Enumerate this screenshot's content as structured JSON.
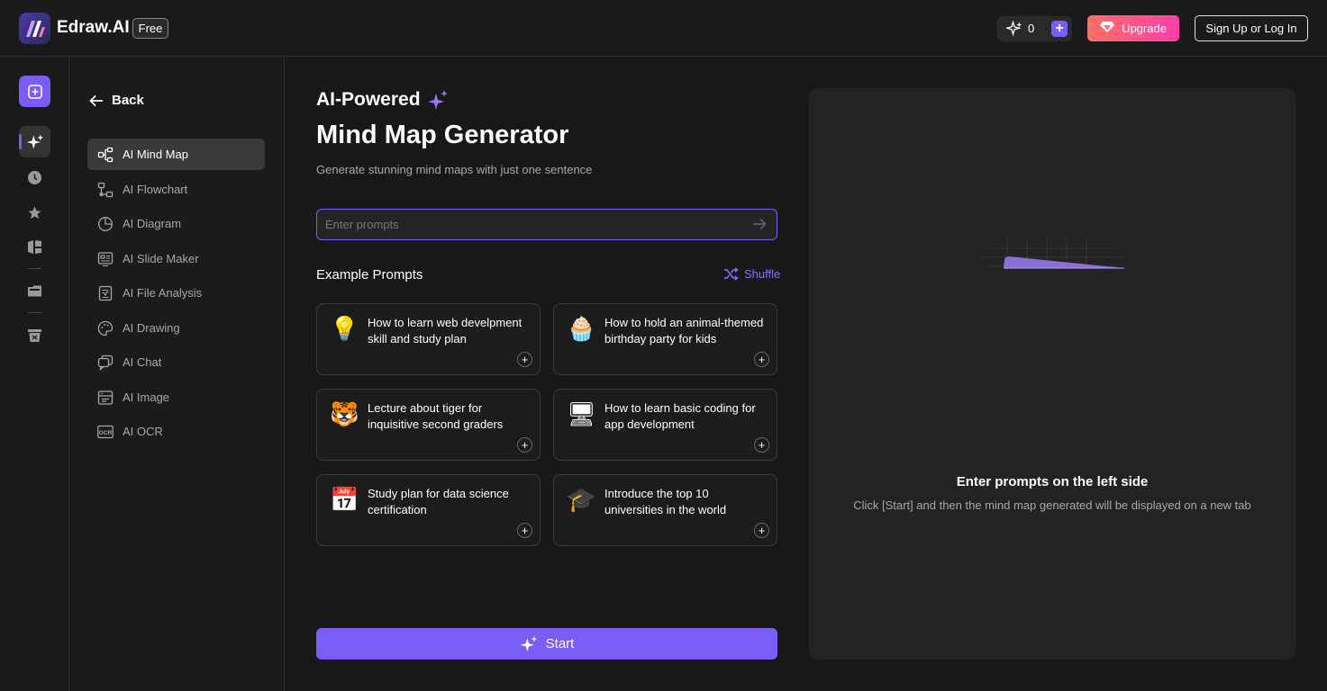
{
  "header": {
    "app_name": "Edraw.AI",
    "plan_badge": "Free",
    "credits": "0",
    "upgrade_label": "Upgrade",
    "signup_label": "Sign Up or Log In"
  },
  "rail": {
    "items": [
      "new-icon",
      "ai-sparkle-icon",
      "clock-icon",
      "star-icon",
      "templates-icon",
      "folder-icon",
      "trash-icon"
    ]
  },
  "sidebar": {
    "back_label": "Back",
    "items": [
      {
        "label": "AI Mind Map",
        "icon": "mind-map-icon",
        "active": true
      },
      {
        "label": "AI Flowchart",
        "icon": "flowchart-icon"
      },
      {
        "label": "AI Diagram",
        "icon": "diagram-icon"
      },
      {
        "label": "AI Slide Maker",
        "icon": "slide-icon"
      },
      {
        "label": "AI File Analysis",
        "icon": "file-analysis-icon"
      },
      {
        "label": "AI Drawing",
        "icon": "palette-icon"
      },
      {
        "label": "AI Chat",
        "icon": "chat-icon"
      },
      {
        "label": "AI Image",
        "icon": "image-icon"
      },
      {
        "label": "AI OCR",
        "icon": "ocr-icon"
      }
    ]
  },
  "main": {
    "eyebrow": "AI-Powered",
    "title": "Mind Map Generator",
    "subtitle": "Generate stunning mind maps with just one sentence",
    "prompt_placeholder": "Enter prompts",
    "examples_title": "Example Prompts",
    "shuffle_label": "Shuffle",
    "examples": [
      {
        "emoji": "💡",
        "text": "How to learn web develpment skill and study plan"
      },
      {
        "emoji": "🧁",
        "text": "How to hold an animal-themed birthday party for kids"
      },
      {
        "emoji": "🐯",
        "text": "Lecture about tiger for inquisitive second graders"
      },
      {
        "emoji": "🖥",
        "text": "How to learn basic coding for app development"
      },
      {
        "emoji": "📅",
        "text": "Study plan for data science certification"
      },
      {
        "emoji": "🎓",
        "text": "Introduce the top 10 universities in the world"
      }
    ],
    "start_label": "Start"
  },
  "preview": {
    "title": "Enter prompts on the left side",
    "subtitle": "Click [Start] and then the mind map generated will be displayed on a new tab"
  },
  "colors": {
    "accent": "#7b5cf5",
    "upgrade_from": "#ff6f61",
    "upgrade_to": "#ff3fae",
    "background": "#181818"
  }
}
